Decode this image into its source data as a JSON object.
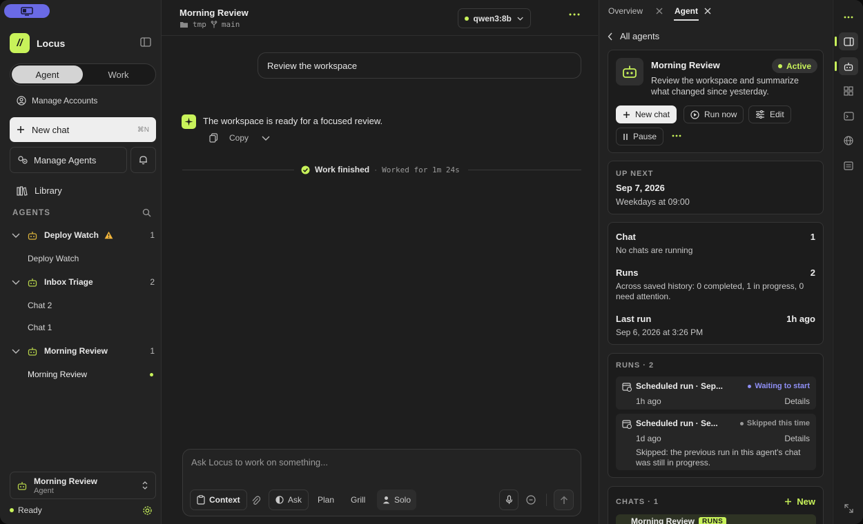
{
  "sidebar": {
    "brand": "Locus",
    "modes": [
      "Agent",
      "Work"
    ],
    "manage_accounts": "Manage Accounts",
    "new_chat": "New chat",
    "new_chat_shortcut": "⌘N",
    "manage_agents": "Manage Agents",
    "library": "Library",
    "agents_header": "AGENTS",
    "groups": [
      {
        "name": "Deploy Watch",
        "count": "1",
        "children": [
          "Deploy Watch"
        ]
      },
      {
        "name": "Inbox Triage",
        "count": "2",
        "children": [
          "Chat 2",
          "Chat 1"
        ]
      },
      {
        "name": "Morning Review",
        "count": "1",
        "children": [
          "Morning Review"
        ]
      }
    ],
    "footer": {
      "title": "Morning Review",
      "subtitle": "Agent",
      "status": "Ready"
    }
  },
  "main": {
    "title": "Morning Review",
    "folder": "tmp",
    "branch": "main",
    "model": "qwen3:8b",
    "user_message": "Review the workspace",
    "assistant_message": "The workspace is ready for a focused review.",
    "copy_label": "Copy",
    "work_finished": "Work finished",
    "separator": "·",
    "worked_for": "Worked for 1m 24s",
    "composer": {
      "placeholder": "Ask Locus to work on something...",
      "context": "Context",
      "ask": "Ask",
      "plan": "Plan",
      "grill": "Grill",
      "solo": "Solo"
    }
  },
  "panel": {
    "tabs": [
      "Overview",
      "Agent"
    ],
    "back": "All agents",
    "agent": {
      "name": "Morning Review",
      "status": "Active",
      "description": "Review the workspace and summarize what changed since yesterday.",
      "buttons": {
        "new_chat": "New chat",
        "run_now": "Run now",
        "edit": "Edit",
        "pause": "Pause"
      }
    },
    "up_next": {
      "label": "UP NEXT",
      "date": "Sep 7, 2026",
      "schedule": "Weekdays at 09:00"
    },
    "stats": {
      "chat_label": "Chat",
      "chat_count": "1",
      "chat_sub": "No chats are running",
      "runs_label": "Runs",
      "runs_count": "2",
      "runs_sub": "Across saved history: 0 completed, 1 in progress, 0 need attention.",
      "last_run_label": "Last run",
      "last_run_ago": "1h ago",
      "last_run_time": "Sep 6, 2026 at 3:26 PM"
    },
    "runs": {
      "header": "RUNS · 2",
      "items": [
        {
          "title": "Scheduled run · Sep...",
          "status": "Waiting to start",
          "ago": "1h ago",
          "details": "Details",
          "note": ""
        },
        {
          "title": "Scheduled run · Se...",
          "status": "Skipped this time",
          "ago": "1d ago",
          "details": "Details",
          "note": "Skipped: the previous run in this agent's chat was still in progress."
        }
      ]
    },
    "chats": {
      "header": "CHATS · 1",
      "new": "New",
      "item": "Morning Review",
      "item_badge": "RUNS"
    }
  },
  "colors": {
    "accent": "#c8f25a",
    "waiting": "#8f8ff5",
    "warning": "#f2b53b",
    "chip": "#6a6ae6"
  }
}
